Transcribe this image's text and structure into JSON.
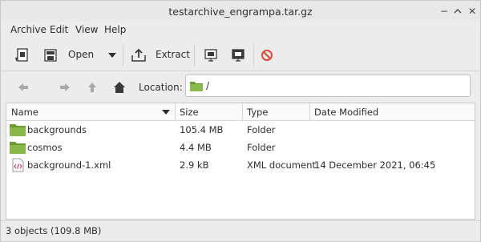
{
  "window": {
    "title": "testarchive_engrampa.tar.gz"
  },
  "menubar": {
    "items": [
      "Archive",
      "Edit",
      "View",
      "Help"
    ]
  },
  "toolbar": {
    "open_label": "Open",
    "extract_label": "Extract"
  },
  "location": {
    "label": "Location:",
    "path": "/"
  },
  "list": {
    "columns": [
      "Name",
      "Size",
      "Type",
      "Date Modified"
    ],
    "rows": [
      {
        "name": "backgrounds",
        "size": "105.4 MB",
        "type": "Folder",
        "date": "",
        "icon": "folder-icon"
      },
      {
        "name": "cosmos",
        "size": "4.4 MB",
        "type": "Folder",
        "date": "",
        "icon": "folder-icon"
      },
      {
        "name": "background-1.xml",
        "size": "2.9 kB",
        "type": "XML document",
        "date": "14 December 2021, 06:45",
        "icon": "xml-file-icon"
      }
    ]
  },
  "status": {
    "text": "3 objects (109.8 MB)"
  },
  "colors": {
    "folder": "#7aa83e",
    "stop": "#e0483a"
  }
}
